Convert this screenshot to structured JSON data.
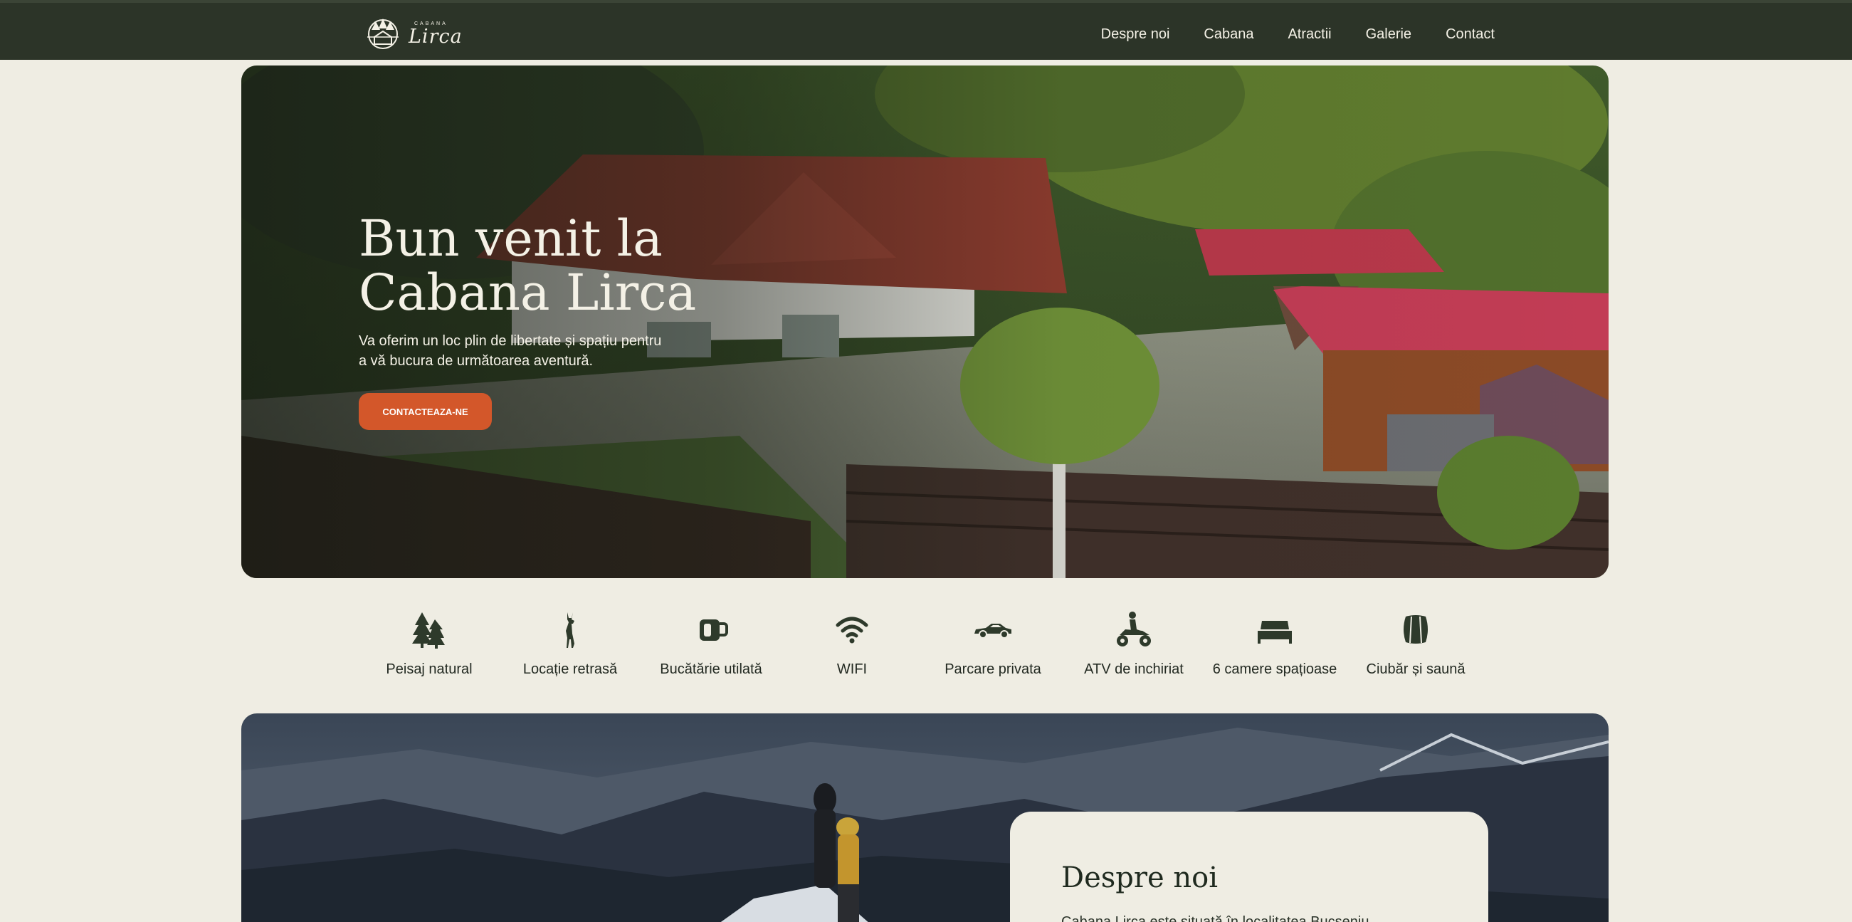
{
  "header": {
    "logo": {
      "small_text": "CABANA",
      "big_text": "Lirca",
      "icon": "forest-cabin-logo-icon"
    },
    "nav": [
      {
        "label": "Despre noi"
      },
      {
        "label": "Cabana"
      },
      {
        "label": "Atractii"
      },
      {
        "label": "Galerie"
      },
      {
        "label": "Contact"
      }
    ]
  },
  "hero": {
    "title": "Bun venit la\nCabana Lirca",
    "subtitle": "Va oferim un loc plin de libertate și spațiu pentru a vă bucura de următoarea aventură.",
    "cta_label": "CONTACTEAZA-NE"
  },
  "amenities": [
    {
      "label": "Peisaj natural",
      "icon": "pine-trees-icon"
    },
    {
      "label": "Locație retrasă",
      "icon": "deer-icon"
    },
    {
      "label": "Bucătărie utilată",
      "icon": "mug-icon"
    },
    {
      "label": "WIFI",
      "icon": "wifi-icon"
    },
    {
      "label": "Parcare privata",
      "icon": "car-icon"
    },
    {
      "label": "ATV de inchiriat",
      "icon": "atv-icon"
    },
    {
      "label": "6 camere spațioase",
      "icon": "bed-icon"
    },
    {
      "label": "Ciubăr și saună",
      "icon": "barrel-icon"
    }
  ],
  "about": {
    "title": "Despre noi",
    "text_fragment": "Cabana Lirca este situată în localitatea Bucșeniu..."
  },
  "colors": {
    "header_bg": "#2c3428",
    "page_bg": "#efede3",
    "accent": "#d3572a",
    "text_dark": "#1f2a1f"
  }
}
